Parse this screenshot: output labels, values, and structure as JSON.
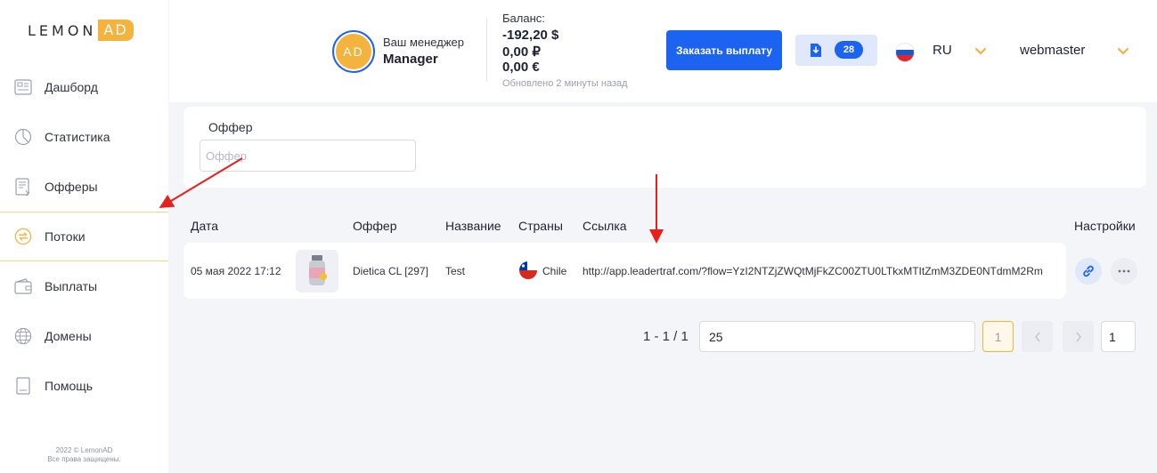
{
  "sidebar": {
    "logo": {
      "left": "LEMON",
      "right": "AD"
    },
    "items": [
      {
        "label": "Дашборд",
        "icon": "dashboard-icon"
      },
      {
        "label": "Статистика",
        "icon": "chart-icon"
      },
      {
        "label": "Офферы",
        "icon": "offers-icon"
      },
      {
        "label": "Потоки",
        "icon": "flows-icon",
        "active": true
      },
      {
        "label": "Выплаты",
        "icon": "wallet-icon"
      },
      {
        "label": "Домены",
        "icon": "globe-icon"
      },
      {
        "label": "Помощь",
        "icon": "help-icon"
      }
    ],
    "copyright_line1": "2022 © LemonAD",
    "copyright_line2": "Все права защищены."
  },
  "header": {
    "manager_initials": "AD",
    "manager_caption": "Ваш менеджер",
    "manager_name": "Manager",
    "balance_title": "Баланс:",
    "balance_usd": "-192,20 $",
    "balance_rub": "0,00 ₽",
    "balance_eur": "0,00 €",
    "balance_updated": "Обновлено 2 минуты назад",
    "payout_button": "Заказать выплату",
    "notifications_count": "28",
    "language": "RU",
    "user": "webmaster"
  },
  "filter": {
    "label": "Оффер",
    "placeholder": "Оффер",
    "value": ""
  },
  "table": {
    "headers": {
      "date": "Дата",
      "offer": "Оффер",
      "name": "Название",
      "countries": "Страны",
      "link": "Ссылка",
      "settings": "Настройки"
    },
    "rows": [
      {
        "date": "05 мая 2022 17:12",
        "offer": "Dietica CL [297]",
        "name": "Test",
        "country": "Chile",
        "link": "http://app.leadertraf.com/?flow=YzI2NTZjZWQtMjFkZC00ZTU0LTkxMTItZmM3ZDE0NTdmM2Rm"
      }
    ]
  },
  "pagination": {
    "range": "1 - 1 / 1",
    "per_page": "25",
    "current_page": "1",
    "page_input": "1"
  },
  "colors": {
    "accent_blue": "#1d63f2",
    "accent_yellow": "#f4b33d",
    "annotation_red": "#e8201c"
  }
}
